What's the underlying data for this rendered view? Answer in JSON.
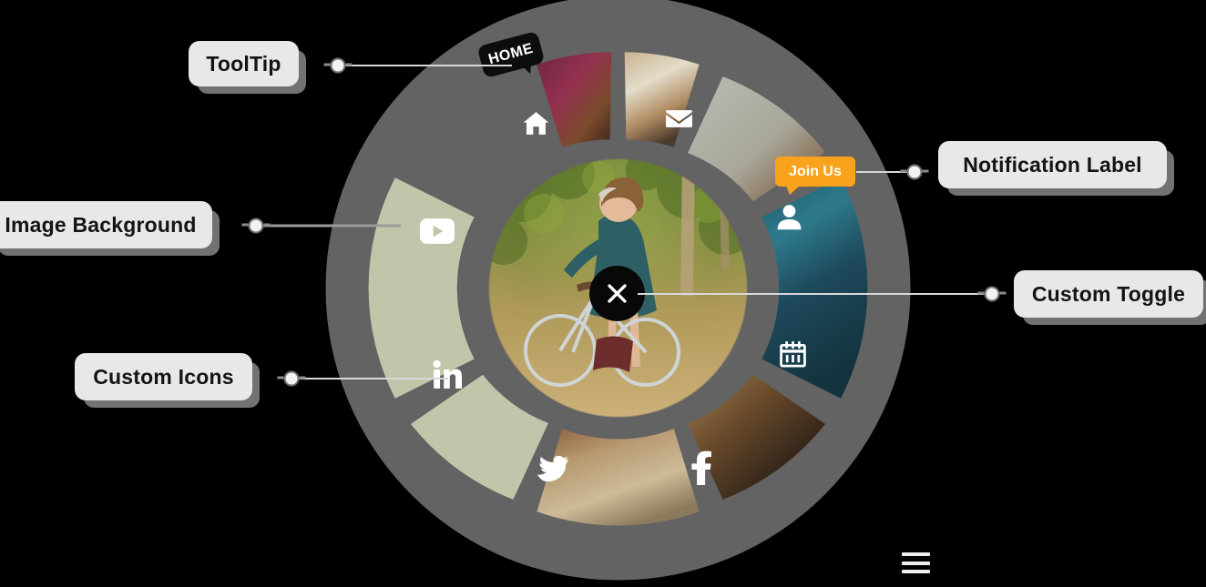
{
  "page": {
    "background_color": "#000000",
    "wheel_ring_color": "#636363",
    "wheel_segment_tint": "#c3c5ab",
    "accent_color": "#f9a21b",
    "label_bg_color": "#e8e8e8",
    "label_shadow_color": "#787878"
  },
  "callouts": [
    {
      "id": "tooltip",
      "label": "ToolTip"
    },
    {
      "id": "image-background",
      "label": "Image Background"
    },
    {
      "id": "custom-icons",
      "label": "Custom Icons"
    },
    {
      "id": "notification-label",
      "label": "Notification Label"
    },
    {
      "id": "custom-toggle",
      "label": "Custom Toggle"
    }
  ],
  "wheel": {
    "tooltip_home": "HOME",
    "notification_join_us": "Join Us",
    "center_toggle_icon": "close-x-icon",
    "segments": [
      {
        "id": "home",
        "icon": "home-icon",
        "fill": "image",
        "has_tooltip": true
      },
      {
        "id": "mail",
        "icon": "mail-icon",
        "fill": "image",
        "has_tooltip": false
      },
      {
        "id": "user",
        "icon": "user-icon",
        "fill": "image",
        "has_tooltip": false,
        "notification": "Join Us"
      },
      {
        "id": "calendar",
        "icon": "calendar-icon",
        "fill": "image",
        "has_tooltip": false
      },
      {
        "id": "facebook",
        "icon": "facebook-icon",
        "fill": "image",
        "has_tooltip": false
      },
      {
        "id": "twitter",
        "icon": "twitter-icon",
        "fill": "image",
        "has_tooltip": false
      },
      {
        "id": "linkedin",
        "icon": "linkedin-icon",
        "fill": "tint",
        "has_tooltip": false
      },
      {
        "id": "youtube",
        "icon": "youtube-icon",
        "fill": "tint",
        "has_tooltip": false
      }
    ]
  },
  "hamburger": {
    "icon": "hamburger-menu-icon"
  }
}
